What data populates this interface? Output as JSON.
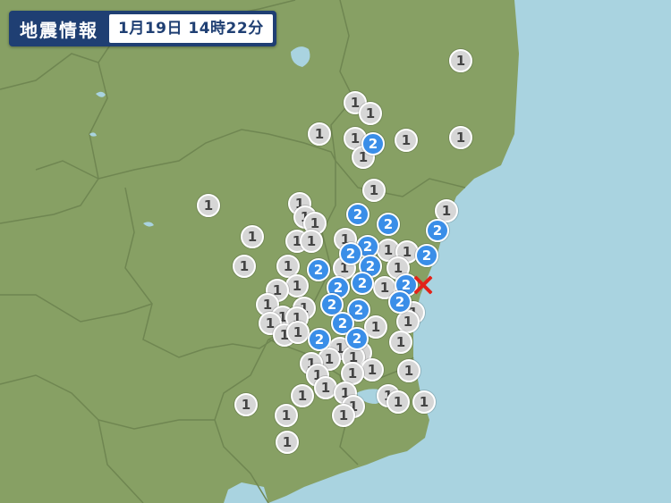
{
  "header": {
    "title": "地震情報",
    "time": "1月19日 14時22分"
  },
  "legend_colors": {
    "sea": "#a9d3e0",
    "land": "#87a064",
    "border": "#6f8651",
    "intensity_1": "#d6d6d6",
    "intensity_2": "#3a8ee8",
    "epicenter": "#e2231a"
  },
  "intensities": {
    "i1": "1",
    "i2": "2"
  },
  "epicenter_icon": "x-mark"
}
